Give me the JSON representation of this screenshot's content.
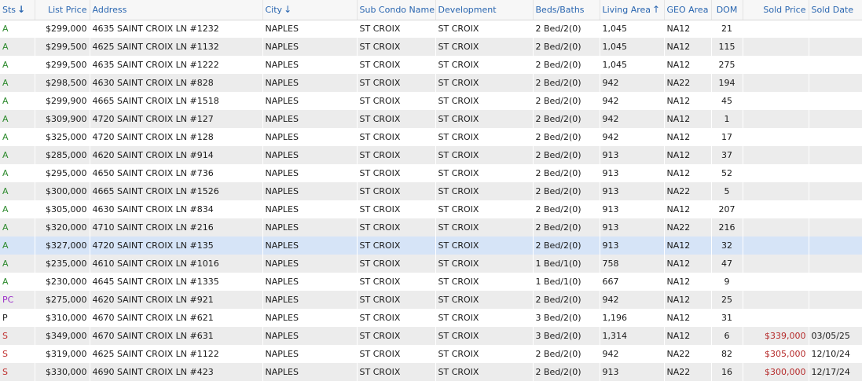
{
  "headers": {
    "sts": "Sts",
    "list_price": "List Price",
    "address": "Address",
    "city": "City",
    "sub_condo_name": "Sub Condo Name",
    "development": "Development",
    "beds_baths": "Beds/Baths",
    "living_area": "Living Area",
    "geo_area": "GEO Area",
    "dom": "DOM",
    "sold_price": "Sold Price",
    "sold_date": "Sold Date"
  },
  "sort_icons": {
    "sts": "↓",
    "city": "↓",
    "living_area": "↑"
  },
  "highlight_row": 12,
  "colors": {
    "status_A": "#2e8b2e",
    "status_PC": "#9b30c8",
    "status_P": "#222222",
    "status_S": "#c0302f",
    "header_text": "#2a66b0",
    "row_highlight": "#d6e4f7"
  },
  "rows": [
    {
      "sts": "A",
      "list_price": "$299,000",
      "address": "4635 SAINT CROIX LN #1232",
      "city": "NAPLES",
      "sub": "ST CROIX",
      "dev": "ST CROIX",
      "beds": "2 Bed/2(0)",
      "area": "1,045",
      "geo": "NA12",
      "dom": "21",
      "sold_price": "",
      "sold_date": ""
    },
    {
      "sts": "A",
      "list_price": "$299,500",
      "address": "4625 SAINT CROIX LN #1132",
      "city": "NAPLES",
      "sub": "ST CROIX",
      "dev": "ST CROIX",
      "beds": "2 Bed/2(0)",
      "area": "1,045",
      "geo": "NA12",
      "dom": "115",
      "sold_price": "",
      "sold_date": ""
    },
    {
      "sts": "A",
      "list_price": "$299,500",
      "address": "4635 SAINT CROIX LN #1222",
      "city": "NAPLES",
      "sub": "ST CROIX",
      "dev": "ST CROIX",
      "beds": "2 Bed/2(0)",
      "area": "1,045",
      "geo": "NA12",
      "dom": "275",
      "sold_price": "",
      "sold_date": ""
    },
    {
      "sts": "A",
      "list_price": "$298,500",
      "address": "4630 SAINT CROIX LN #828",
      "city": "NAPLES",
      "sub": "ST CROIX",
      "dev": "ST CROIX",
      "beds": "2 Bed/2(0)",
      "area": "942",
      "geo": "NA22",
      "dom": "194",
      "sold_price": "",
      "sold_date": ""
    },
    {
      "sts": "A",
      "list_price": "$299,900",
      "address": "4665 SAINT CROIX LN #1518",
      "city": "NAPLES",
      "sub": "ST CROIX",
      "dev": "ST CROIX",
      "beds": "2 Bed/2(0)",
      "area": "942",
      "geo": "NA12",
      "dom": "45",
      "sold_price": "",
      "sold_date": ""
    },
    {
      "sts": "A",
      "list_price": "$309,900",
      "address": "4720 SAINT CROIX LN #127",
      "city": "NAPLES",
      "sub": "ST CROIX",
      "dev": "ST CROIX",
      "beds": "2 Bed/2(0)",
      "area": "942",
      "geo": "NA12",
      "dom": "1",
      "sold_price": "",
      "sold_date": ""
    },
    {
      "sts": "A",
      "list_price": "$325,000",
      "address": "4720 SAINT CROIX LN #128",
      "city": "NAPLES",
      "sub": "ST CROIX",
      "dev": "ST CROIX",
      "beds": "2 Bed/2(0)",
      "area": "942",
      "geo": "NA12",
      "dom": "17",
      "sold_price": "",
      "sold_date": ""
    },
    {
      "sts": "A",
      "list_price": "$285,000",
      "address": "4620 SAINT CROIX LN #914",
      "city": "NAPLES",
      "sub": "ST CROIX",
      "dev": "ST CROIX",
      "beds": "2 Bed/2(0)",
      "area": "913",
      "geo": "NA12",
      "dom": "37",
      "sold_price": "",
      "sold_date": ""
    },
    {
      "sts": "A",
      "list_price": "$295,000",
      "address": "4650 SAINT CROIX LN #736",
      "city": "NAPLES",
      "sub": "ST CROIX",
      "dev": "ST CROIX",
      "beds": "2 Bed/2(0)",
      "area": "913",
      "geo": "NA12",
      "dom": "52",
      "sold_price": "",
      "sold_date": ""
    },
    {
      "sts": "A",
      "list_price": "$300,000",
      "address": "4665 SAINT CROIX LN #1526",
      "city": "NAPLES",
      "sub": "ST CROIX",
      "dev": "ST CROIX",
      "beds": "2 Bed/2(0)",
      "area": "913",
      "geo": "NA22",
      "dom": "5",
      "sold_price": "",
      "sold_date": ""
    },
    {
      "sts": "A",
      "list_price": "$305,000",
      "address": "4630 SAINT CROIX LN #834",
      "city": "NAPLES",
      "sub": "ST CROIX",
      "dev": "ST CROIX",
      "beds": "2 Bed/2(0)",
      "area": "913",
      "geo": "NA12",
      "dom": "207",
      "sold_price": "",
      "sold_date": ""
    },
    {
      "sts": "A",
      "list_price": "$320,000",
      "address": "4710 SAINT CROIX LN #216",
      "city": "NAPLES",
      "sub": "ST CROIX",
      "dev": "ST CROIX",
      "beds": "2 Bed/2(0)",
      "area": "913",
      "geo": "NA22",
      "dom": "216",
      "sold_price": "",
      "sold_date": ""
    },
    {
      "sts": "A",
      "list_price": "$327,000",
      "address": "4720 SAINT CROIX LN #135",
      "city": "NAPLES",
      "sub": "ST CROIX",
      "dev": "ST CROIX",
      "beds": "2 Bed/2(0)",
      "area": "913",
      "geo": "NA12",
      "dom": "32",
      "sold_price": "",
      "sold_date": ""
    },
    {
      "sts": "A",
      "list_price": "$235,000",
      "address": "4610 SAINT CROIX LN #1016",
      "city": "NAPLES",
      "sub": "ST CROIX",
      "dev": "ST CROIX",
      "beds": "1 Bed/1(0)",
      "area": "758",
      "geo": "NA12",
      "dom": "47",
      "sold_price": "",
      "sold_date": ""
    },
    {
      "sts": "A",
      "list_price": "$230,000",
      "address": "4645 SAINT CROIX LN #1335",
      "city": "NAPLES",
      "sub": "ST CROIX",
      "dev": "ST CROIX",
      "beds": "1 Bed/1(0)",
      "area": "667",
      "geo": "NA12",
      "dom": "9",
      "sold_price": "",
      "sold_date": ""
    },
    {
      "sts": "PC",
      "list_price": "$275,000",
      "address": "4620 SAINT CROIX LN #921",
      "city": "NAPLES",
      "sub": "ST CROIX",
      "dev": "ST CROIX",
      "beds": "2 Bed/2(0)",
      "area": "942",
      "geo": "NA12",
      "dom": "25",
      "sold_price": "",
      "sold_date": ""
    },
    {
      "sts": "P",
      "list_price": "$310,000",
      "address": "4670 SAINT CROIX LN #621",
      "city": "NAPLES",
      "sub": "ST CROIX",
      "dev": "ST CROIX",
      "beds": "3 Bed/2(0)",
      "area": "1,196",
      "geo": "NA12",
      "dom": "31",
      "sold_price": "",
      "sold_date": ""
    },
    {
      "sts": "S",
      "list_price": "$349,000",
      "address": "4670 SAINT CROIX LN #631",
      "city": "NAPLES",
      "sub": "ST CROIX",
      "dev": "ST CROIX",
      "beds": "3 Bed/2(0)",
      "area": "1,314",
      "geo": "NA12",
      "dom": "6",
      "sold_price": "$339,000",
      "sold_date": "03/05/25"
    },
    {
      "sts": "S",
      "list_price": "$319,000",
      "address": "4625 SAINT CROIX LN #1122",
      "city": "NAPLES",
      "sub": "ST CROIX",
      "dev": "ST CROIX",
      "beds": "2 Bed/2(0)",
      "area": "942",
      "geo": "NA22",
      "dom": "82",
      "sold_price": "$305,000",
      "sold_date": "12/10/24"
    },
    {
      "sts": "S",
      "list_price": "$330,000",
      "address": "4690 SAINT CROIX LN #423",
      "city": "NAPLES",
      "sub": "ST CROIX",
      "dev": "ST CROIX",
      "beds": "2 Bed/2(0)",
      "area": "913",
      "geo": "NA22",
      "dom": "16",
      "sold_price": "$300,000",
      "sold_date": "12/17/24"
    }
  ]
}
